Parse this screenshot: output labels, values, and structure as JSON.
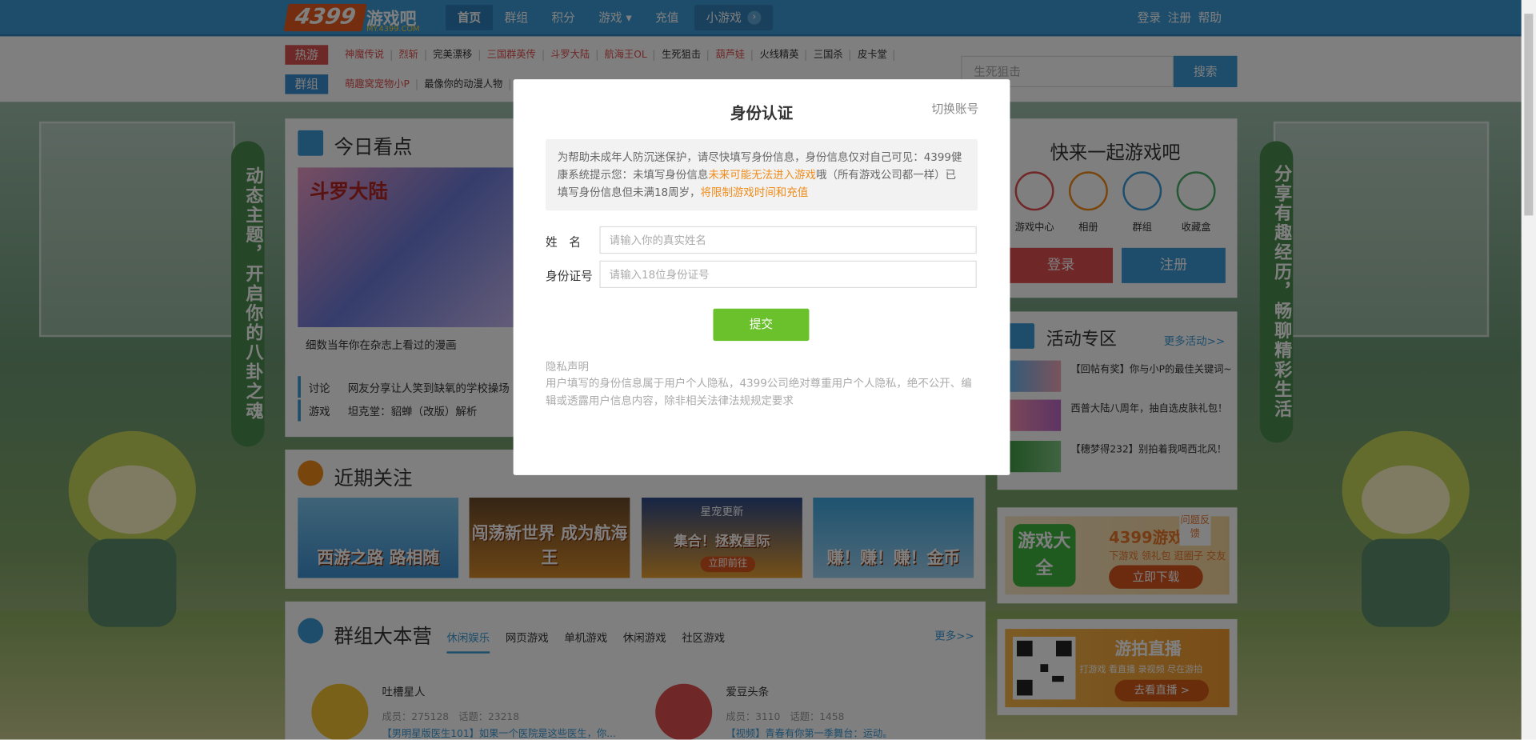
{
  "header": {
    "logo_main": "4399",
    "logo_sub": "游戏吧",
    "logo_url_text": "MY.4399.COM",
    "nav": [
      "首页",
      "群组",
      "积分",
      "游戏",
      "充值"
    ],
    "nav_active": "首页",
    "xiao_label": "小游戏",
    "right_links": [
      "登录",
      "注册",
      "帮助"
    ]
  },
  "hot": {
    "tag1": "热游",
    "tag2": "群组",
    "row1": [
      {
        "text": "神魔传说",
        "color": "red"
      },
      {
        "text": "烈斩",
        "color": "red"
      },
      {
        "text": "完美漂移",
        "color": "dark"
      },
      {
        "text": "三国群英传",
        "color": "red"
      },
      {
        "text": "斗罗大陆",
        "color": "red"
      },
      {
        "text": "航海王OL",
        "color": "red"
      },
      {
        "text": "生死狙击",
        "color": "dark"
      },
      {
        "text": "葫芦娃",
        "color": "red"
      },
      {
        "text": "火线精英",
        "color": "dark"
      },
      {
        "text": "三国杀",
        "color": "dark"
      },
      {
        "text": "皮卡堂",
        "color": "dark"
      }
    ],
    "row2": [
      {
        "text": "萌趣窝宠物小P",
        "color": "red"
      },
      {
        "text": "最像你的动漫人物",
        "color": "dark"
      }
    ]
  },
  "search": {
    "placeholder": "生死狙击",
    "button": "搜索"
  },
  "side_text": {
    "left": "动态主题，开启你的八卦之魂",
    "right": "分享有趣经历，畅聊精彩生活"
  },
  "today": {
    "title": "今日看点",
    "image_title": "斗罗大陆",
    "caption": "细数当年你在杂志上看过的漫画",
    "rows": [
      {
        "k": "讨论",
        "v": "网友分享让人笑到缺氧的学校操场"
      },
      {
        "k": "游戏",
        "v": "坦克堂：貂蝉（改版）解析"
      }
    ]
  },
  "recent": {
    "title": "近期关注",
    "banners": [
      "西游之路 路相随",
      "闯荡新世界 成为航海王",
      "集合！拯救星际",
      "赚！赚！赚！金币"
    ],
    "banner3_top": "星宠更新",
    "banner3_btn": "立即前往"
  },
  "groups": {
    "title": "群组大本营",
    "tabs": [
      "休闲娱乐",
      "网页游戏",
      "单机游戏",
      "休闲游戏",
      "社区游戏"
    ],
    "more": "更多>>",
    "cards": [
      {
        "name": "吐槽星人",
        "members": "成员：275128",
        "topics": "话题：23218",
        "post": "【男明星版医生101】如果一个医院是这些医生，你..."
      },
      {
        "name": "爱豆头条",
        "members": "成员：3110",
        "topics": "话题：1458",
        "post": "【视频】青春有你第一季舞台：运动。"
      }
    ]
  },
  "quick": {
    "title": "快来一起游戏吧",
    "icons": [
      "游戏中心",
      "相册",
      "群组",
      "收藏盒"
    ],
    "login": "登录",
    "register": "注册"
  },
  "activity": {
    "title": "活动专区",
    "more": "更多活动>>",
    "items": [
      "【回帖有奖】你与小P的最佳关键词~",
      "西普大陆八周年，抽自选皮肤礼包！",
      "【穗梦得232】别拍着我喝西北风！"
    ]
  },
  "promo": {
    "icon_text": "游戏大全",
    "title": "4399游戏",
    "sub": "下游戏 领礼包 逛圈子 交友",
    "button": "立即下载",
    "feedback": "问题反馈"
  },
  "live": {
    "title": "游拍直播",
    "sub": "打游戏 看直播 录视频 尽在游拍",
    "button": "去看直播 >"
  },
  "modal": {
    "title": "身份认证",
    "switch": "切换账号",
    "notice_a": "为帮助未成年人防沉迷保护，请尽快填写身份信息，身份信息仅对自己可见：4399健康系统提示您：未填写身份信息",
    "notice_b": "未来可能无法进入游戏",
    "notice_c": "哦（所有游戏公司都一样）已填写身份信息但未满18周岁，",
    "notice_d": "将限制游戏时间和充值",
    "name_label": "姓　名",
    "name_placeholder": "请输入你的真实姓名",
    "id_label": "身份证号",
    "id_placeholder": "请输入18位身份证号",
    "submit": "提交",
    "privacy_title": "隐私声明",
    "privacy_text": "用户填写的身份信息属于用户个人隐私，4399公司绝对尊重用户个人隐私，绝不公开、编辑或透露用户信息内容，除非相关法律法规规定要求"
  },
  "colors": {
    "brand_blue": "#3b9ad6",
    "red": "#e14f4f",
    "orange": "#f08c1b",
    "green": "#6ac12c"
  }
}
